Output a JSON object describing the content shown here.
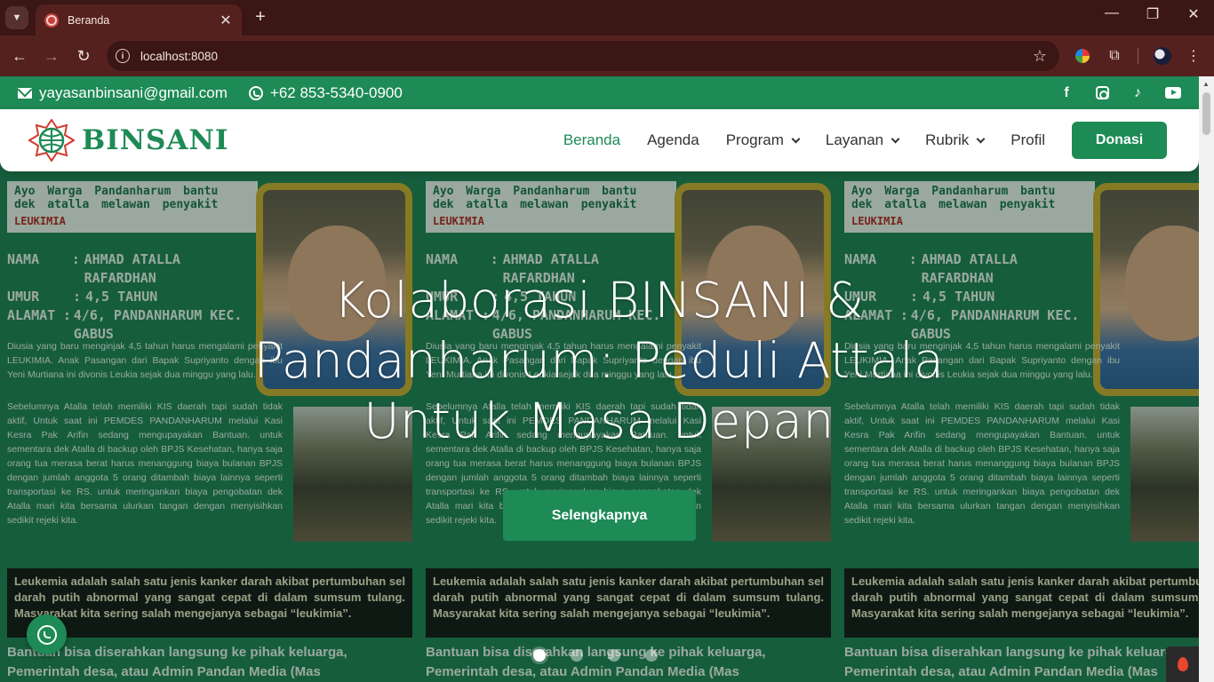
{
  "browser": {
    "tab_title": "Beranda",
    "new_tab_symbol": "+",
    "url": "localhost:8080",
    "window_controls": [
      "—",
      "❐",
      "✕"
    ]
  },
  "topbar": {
    "email": "yayasanbinsani@gmail.com",
    "phone": "+62 853-5340-0900",
    "socials": [
      "facebook-icon",
      "instagram-icon",
      "tiktok-icon",
      "youtube-icon"
    ]
  },
  "nav": {
    "logo_text": "BINSANI",
    "items": [
      {
        "label": "Beranda",
        "active": true,
        "dropdown": false
      },
      {
        "label": "Agenda",
        "dropdown": false
      },
      {
        "label": "Program",
        "dropdown": true
      },
      {
        "label": "Layanan",
        "dropdown": true
      },
      {
        "label": "Rubrik",
        "dropdown": true
      },
      {
        "label": "Profil",
        "dropdown": false
      }
    ],
    "donate_label": "Donasi"
  },
  "poster": {
    "heading": "Ayo Warga Pandanharum bantu dek atalla melawan penyakit",
    "heading_red": "LEUKIMIA",
    "fields": [
      {
        "key": "NAMA",
        "value": "AHMAD ATALLA RAFARDHAN"
      },
      {
        "key": "UMUR",
        "value": "4,5 TAHUN"
      },
      {
        "key": "ALAMAT",
        "value": "4/6, PANDANHARUM KEC. GABUS"
      }
    ],
    "para1": "Diusia yang baru menginjak 4,5 tahun harus mengalami penyakit LEUKIMIA. Anak Pasangan dari Bapak Supriyanto dengan ibu Yeni Murtiana ini divonis Leukia sejak dua minggu yang lalu.",
    "para2": "Sebelumnya Atalla telah memiliki KIS daerah tapi sudah tidak aktif, Untuk saat ini PEMDES PANDANHARUM melalui Kasi Kesra Pak Arifin sedang mengupayakan Bantuan. untuk sementara dek Atalla di backup oleh BPJS Kesehatan, hanya saja orang tua merasa berat harus menanggung biaya bulanan BPJS dengan jumlah anggota 5 orang ditambah biaya lainnya seperti transportasi ke RS. untuk meringankan biaya pengobatan dek Atalla mari kita bersama ulurkan tangan dengan menyisihkan sedikit rejeki kita.",
    "black_box": "Leukemia adalah salah satu jenis kanker darah akibat pertumbuhan sel darah putih abnormal yang sangat cepat di dalam sumsum tulang. Masyarakat kita sering salah mengejanya sebagai “leukimia”.",
    "bottom_text": "Bantuan bisa diserahkan langsung ke pihak keluarga, Pemerintah desa, atau Admin Pandan Media (Mas"
  },
  "hero": {
    "title": "Kolaborasi BINSANI & Pandanharum: Peduli Attala Untuk Masa Depan",
    "button_label": "Selengkapnya",
    "slide_count": 4,
    "active_slide": 1
  },
  "colors": {
    "brand_green": "#1e8a55",
    "browser_frame": "#55211e"
  }
}
